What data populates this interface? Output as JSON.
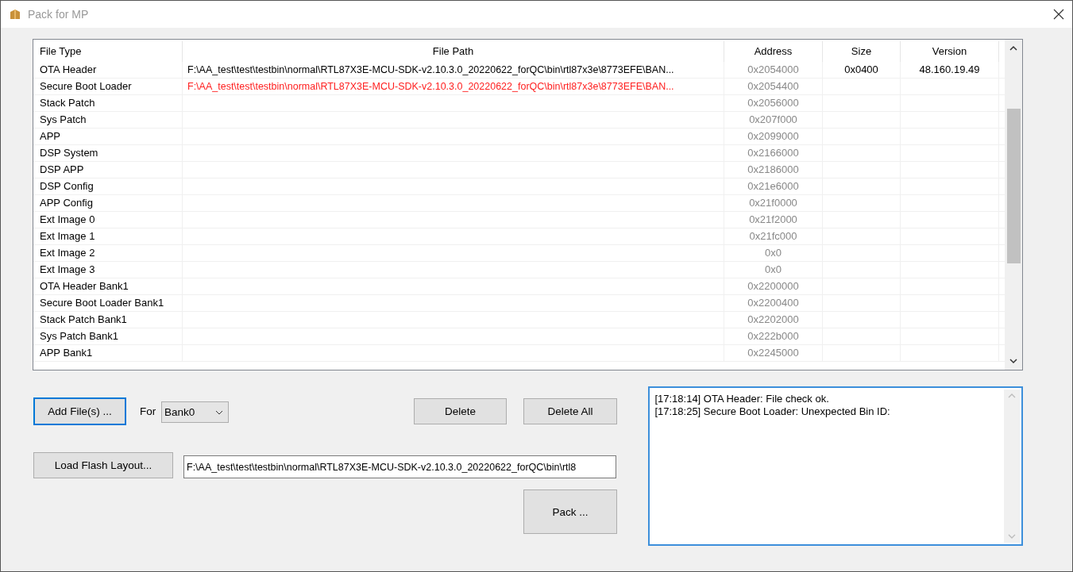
{
  "window": {
    "title": "Pack for MP"
  },
  "table": {
    "columns": [
      "File Type",
      "File Path",
      "Address",
      "Size",
      "Version"
    ],
    "rows": [
      {
        "file_type": "OTA Header",
        "file_path": "F:\\AA_test\\test\\testbin\\normal\\RTL87X3E-MCU-SDK-v2.10.3.0_20220622_forQC\\bin\\rtl87x3e\\8773EFE\\BAN...",
        "error": false,
        "address": "0x2054000",
        "size": "0x0400",
        "version": "48.160.19.49"
      },
      {
        "file_type": "Secure Boot Loader",
        "file_path": "F:\\AA_test\\test\\testbin\\normal\\RTL87X3E-MCU-SDK-v2.10.3.0_20220622_forQC\\bin\\rtl87x3e\\8773EFE\\BAN...",
        "error": true,
        "address": "0x2054400"
      },
      {
        "file_type": "Stack Patch",
        "address": "0x2056000"
      },
      {
        "file_type": "Sys Patch",
        "address": "0x207f000"
      },
      {
        "file_type": "APP",
        "address": "0x2099000"
      },
      {
        "file_type": "DSP System",
        "address": "0x2166000"
      },
      {
        "file_type": "DSP APP",
        "address": "0x2186000"
      },
      {
        "file_type": "DSP Config",
        "address": "0x21e6000"
      },
      {
        "file_type": "APP Config",
        "address": "0x21f0000"
      },
      {
        "file_type": "Ext Image 0",
        "address": "0x21f2000"
      },
      {
        "file_type": "Ext Image 1",
        "address": "0x21fc000"
      },
      {
        "file_type": "Ext Image 2",
        "address": "0x0"
      },
      {
        "file_type": "Ext Image 3",
        "address": "0x0"
      },
      {
        "file_type": "OTA Header Bank1",
        "address": "0x2200000"
      },
      {
        "file_type": "Secure Boot Loader Bank1",
        "address": "0x2200400"
      },
      {
        "file_type": "Stack Patch Bank1",
        "address": "0x2202000"
      },
      {
        "file_type": "Sys Patch Bank1",
        "address": "0x222b000"
      },
      {
        "file_type": "APP Bank1",
        "address": "0x2245000"
      }
    ]
  },
  "add_files_button": "Add File(s) ...",
  "for_label": "For",
  "bank_select": {
    "value": "Bank0"
  },
  "delete_button": "Delete",
  "delete_all_button": "Delete All",
  "load_flash_layout_button": "Load Flash Layout...",
  "flash_layout_path": {
    "value": "F:\\AA_test\\test\\testbin\\normal\\RTL87X3E-MCU-SDK-v2.10.3.0_20220622_forQC\\bin\\rtl8"
  },
  "pack_button": "Pack ...",
  "log": [
    "[17:18:14] OTA Header: File check ok.",
    "[17:18:25] Secure Boot Loader: Unexpected Bin ID:"
  ]
}
